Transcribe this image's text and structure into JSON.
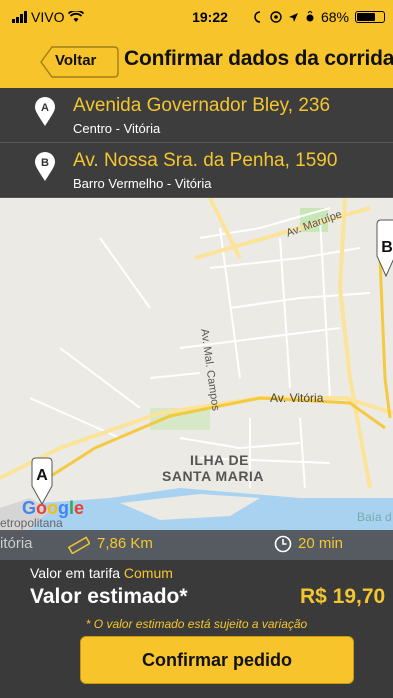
{
  "status_bar": {
    "carrier": "VIVO",
    "time": "19:22",
    "battery": "68%",
    "battery_level": 0.68
  },
  "nav": {
    "back_label": "Voltar",
    "title": "Confirmar dados da corrida"
  },
  "addresses": [
    {
      "marker": "A",
      "street": "Avenida Governador Bley, 236",
      "district": "Centro - Vitória"
    },
    {
      "marker": "B",
      "street": "Av. Nossa Sra. da Penha, 1590",
      "district": "Barro Vermelho - Vitória"
    }
  ],
  "map": {
    "labels": {
      "maruipe": "Av. Maruípe",
      "mal_campos": "Av. Mal. Campos",
      "vitoria": "Av. Vitória",
      "ilha1": "ILHA DE",
      "ilha2": "SANTA MARIA",
      "metro1": "etropolitana",
      "metro2": "itória",
      "baia": "Baía d"
    },
    "marker_a": "A",
    "marker_b": "B",
    "google": [
      "G",
      "o",
      "o",
      "g",
      "l",
      "e"
    ],
    "colors": {
      "water": "#a9d2f0",
      "road": "#fbe39a",
      "park": "#c8e6b6"
    }
  },
  "trip": {
    "distance": "7,86 Km",
    "duration": "20 min"
  },
  "pricing": {
    "tariff_prefix": "Valor em tarifa",
    "tariff_name": "Comum",
    "estimate_label": "Valor estimado*",
    "estimate_value": "R$ 19,70",
    "disclaimer": "* O valor estimado está sujeito a variação"
  },
  "actions": {
    "confirm_label": "Confirmar pedido"
  },
  "icons": {
    "signal": "signal-icon",
    "wifi": "wifi-icon",
    "alarm": "alarm-icon",
    "location": "location-arrow-icon",
    "bluetooth": "bluetooth-icon",
    "ruler": "ruler-icon",
    "clock": "clock-icon"
  }
}
